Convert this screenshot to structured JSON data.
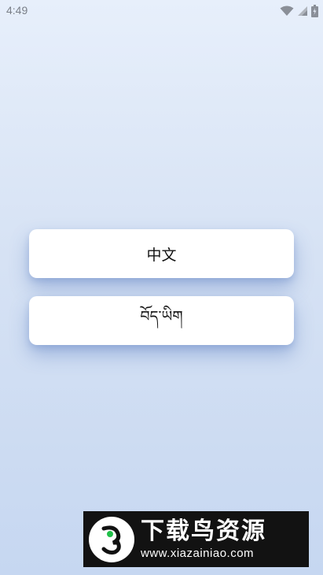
{
  "status_bar": {
    "time": "4:49",
    "icons": [
      "wifi-icon",
      "signal-icon",
      "battery-icon"
    ]
  },
  "language_options": {
    "chinese_label": "中文",
    "tibetan_label": "བོད་ཡིག"
  },
  "watermark": {
    "title": "下载鸟资源",
    "url": "www.xiazainiao.com"
  },
  "colors": {
    "background_top": "#e7effb",
    "background_bottom": "#c6d7f1",
    "button_background": "#ffffff",
    "watermark_background": "#121212"
  }
}
